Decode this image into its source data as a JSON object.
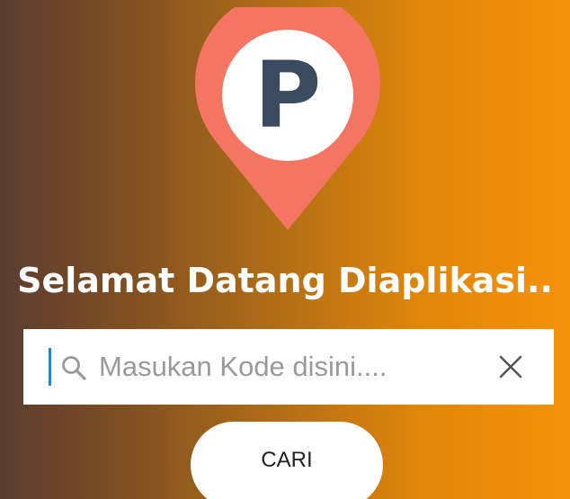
{
  "logo": {
    "icon": "parking-location-pin-icon",
    "letter": "P",
    "colors": {
      "pin": "#f47562",
      "circle": "#ffffff",
      "letter": "#3b4a5e"
    }
  },
  "welcome_text": "Selamat Datang Diaplikasi..",
  "search": {
    "placeholder": "Masukan Kode disini....",
    "value": "",
    "search_icon": "search-icon",
    "clear_icon": "close-icon",
    "caret_color": "#2a86c8"
  },
  "cari_button": {
    "label": "CARI"
  },
  "colors": {
    "background_left": "#5a3c30",
    "background_right": "#f5920a"
  }
}
